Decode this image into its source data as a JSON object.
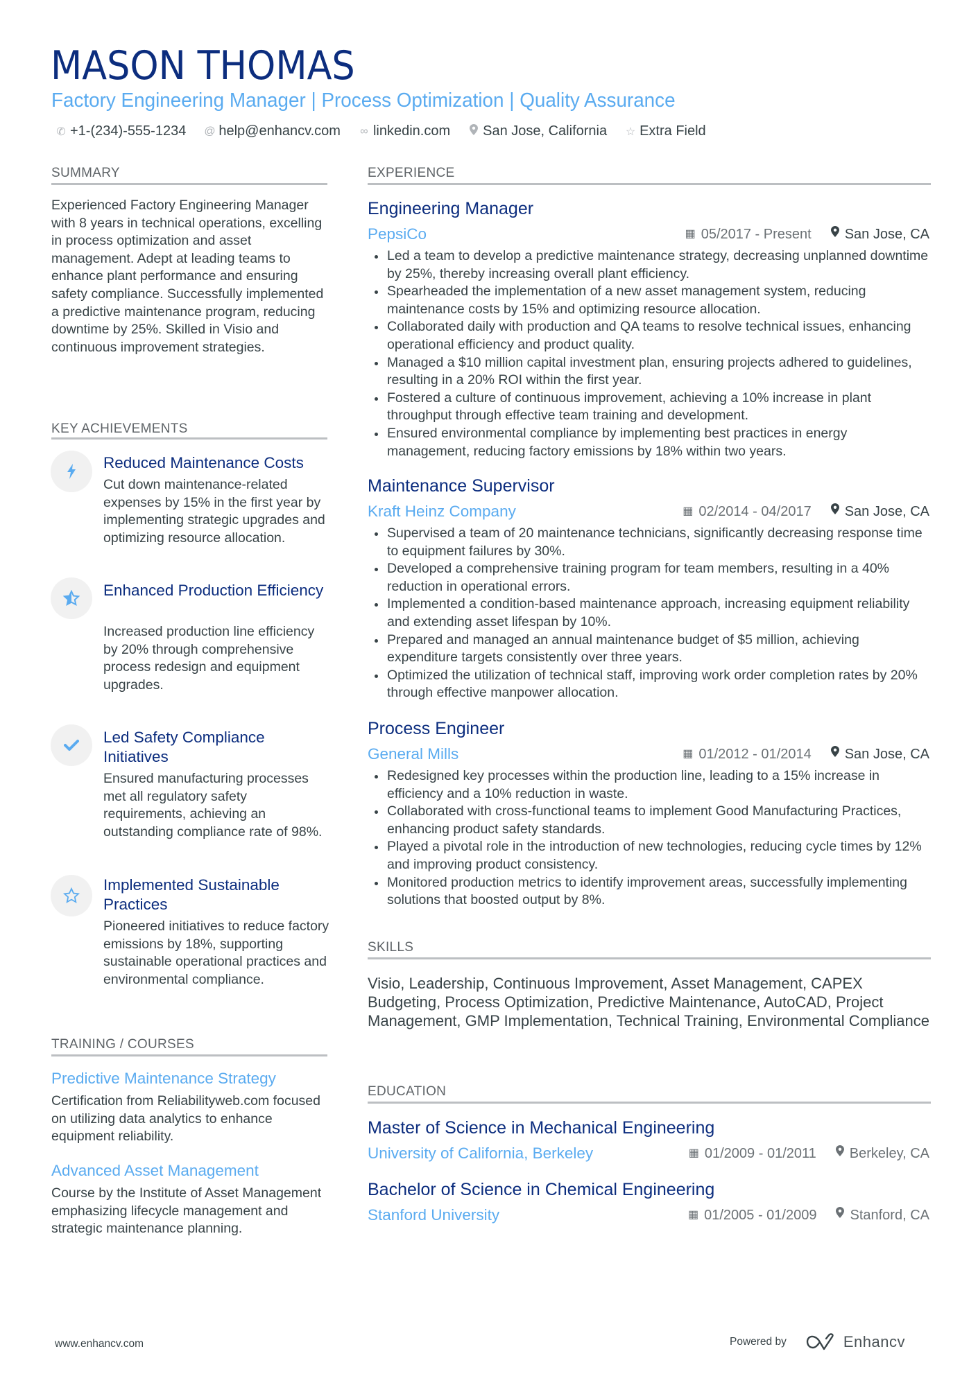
{
  "header": {
    "name": "MASON THOMAS",
    "headline": "Factory Engineering Manager | Process Optimization | Quality Assurance",
    "contacts": [
      {
        "icon": "phone-icon",
        "glyph": "✆",
        "text": "+1-(234)-555-1234"
      },
      {
        "icon": "at-icon",
        "glyph": "@",
        "text": "help@enhancv.com"
      },
      {
        "icon": "link-icon",
        "glyph": "∞",
        "text": "linkedin.com"
      },
      {
        "icon": "location-pin-icon",
        "glyph": "●",
        "text": "San Jose, California"
      },
      {
        "icon": "star-icon",
        "glyph": "☆",
        "text": "Extra Field"
      }
    ]
  },
  "summary": {
    "title": "SUMMARY",
    "text": "Experienced Factory Engineering Manager with 8 years in technical operations, excelling in process optimization and asset management. Adept at leading teams to enhance plant performance and ensuring safety compliance. Successfully implemented a predictive maintenance program, reducing downtime by 25%. Skilled in Visio and continuous improvement strategies."
  },
  "achievements": {
    "title": "KEY ACHIEVEMENTS",
    "items": [
      {
        "icon": "lightning-bolt-icon",
        "glyph": "ϟ",
        "title": "Reduced Maintenance Costs",
        "desc": "Cut down maintenance-related expenses by 15% in the first year by implementing strategic upgrades and optimizing resource allocation."
      },
      {
        "icon": "half-star-icon",
        "glyph": "★",
        "title": "Enhanced Production Efficiency",
        "desc": "Increased production line efficiency by 20% through comprehensive process redesign and equipment upgrades."
      },
      {
        "icon": "checkmark-icon",
        "glyph": "✔",
        "title": "Led Safety Compliance Initiatives",
        "desc": "Ensured manufacturing processes met all regulatory safety requirements, achieving an outstanding compliance rate of 98%."
      },
      {
        "icon": "star-outline-icon",
        "glyph": "☆",
        "title": "Implemented Sustainable Practices",
        "desc": "Pioneered initiatives to reduce factory emissions by 18%, supporting sustainable operational practices and environmental compliance."
      }
    ]
  },
  "training": {
    "title": "TRAINING / COURSES",
    "items": [
      {
        "title": "Predictive Maintenance Strategy",
        "desc": "Certification from Reliabilityweb.com focused on utilizing data analytics to enhance equipment reliability."
      },
      {
        "title": "Advanced Asset Management",
        "desc": "Course by the Institute of Asset Management emphasizing lifecycle management and strategic maintenance planning."
      }
    ]
  },
  "experience": {
    "title": "EXPERIENCE",
    "jobs": [
      {
        "title": "Engineering Manager",
        "company": "PepsiCo",
        "dates": "05/2017 - Present",
        "location": "San Jose, CA",
        "bullets": [
          "Led a team to develop a predictive maintenance strategy, decreasing unplanned downtime by 25%, thereby increasing overall plant efficiency.",
          "Spearheaded the implementation of a new asset management system, reducing maintenance costs by 15% and optimizing resource allocation.",
          "Collaborated daily with production and QA teams to resolve technical issues, enhancing operational efficiency and product quality.",
          "Managed a $10 million capital investment plan, ensuring projects adhered to guidelines, resulting in a 20% ROI within the first year.",
          "Fostered a culture of continuous improvement, achieving a 10% increase in plant throughput through effective team training and development.",
          "Ensured environmental compliance by implementing best practices in energy management, reducing factory emissions by 18% within two years."
        ]
      },
      {
        "title": "Maintenance Supervisor",
        "company": "Kraft Heinz Company",
        "dates": "02/2014 - 04/2017",
        "location": "San Jose, CA",
        "bullets": [
          "Supervised a team of 20 maintenance technicians, significantly decreasing response time to equipment failures by 30%.",
          "Developed a comprehensive training program for team members, resulting in a 40% reduction in operational errors.",
          "Implemented a condition-based maintenance approach, increasing equipment reliability and extending asset lifespan by 10%.",
          "Prepared and managed an annual maintenance budget of $5 million, achieving expenditure targets consistently over three years.",
          "Optimized the utilization of technical staff, improving work order completion rates by 20% through effective manpower allocation."
        ]
      },
      {
        "title": "Process Engineer",
        "company": "General Mills",
        "dates": "01/2012 - 01/2014",
        "location": "San Jose, CA",
        "bullets": [
          "Redesigned key processes within the production line, leading to a 15% increase in efficiency and a 10% reduction in waste.",
          "Collaborated with cross-functional teams to implement Good Manufacturing Practices, enhancing product safety standards.",
          "Played a pivotal role in the introduction of new technologies, reducing cycle times by 12% and improving product consistency.",
          "Monitored production metrics to identify improvement areas, successfully implementing solutions that boosted output by 8%."
        ]
      }
    ]
  },
  "skills": {
    "title": "SKILLS",
    "text": "Visio, Leadership, Continuous Improvement, Asset Management, CAPEX Budgeting, Process Optimization, Predictive Maintenance, AutoCAD, Project Management, GMP Implementation, Technical Training, Environmental Compliance"
  },
  "education": {
    "title": "EDUCATION",
    "items": [
      {
        "degree": "Master of Science in Mechanical Engineering",
        "school": "University of California, Berkeley",
        "dates": "01/2009 - 01/2011",
        "location": "Berkeley, CA"
      },
      {
        "degree": "Bachelor of Science in Chemical Engineering",
        "school": "Stanford University",
        "dates": "01/2005 - 01/2009",
        "location": "Stanford, CA"
      }
    ]
  },
  "footer": {
    "website": "www.enhancv.com",
    "powered_by": "Powered by",
    "brand": "Enhancv"
  },
  "icons": {
    "calendar": "▦",
    "pin": "●"
  }
}
